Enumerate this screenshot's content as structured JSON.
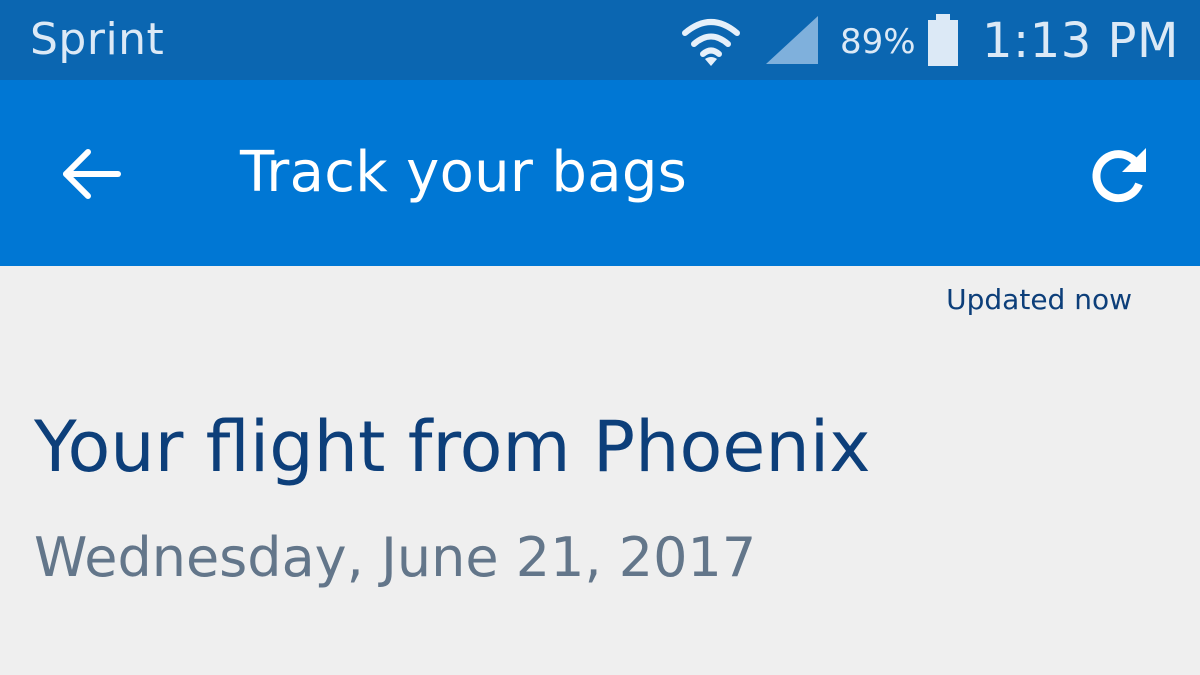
{
  "status_bar": {
    "carrier": "Sprint",
    "battery_percent": "89%",
    "time": "1:13 PM",
    "icons": {
      "wifi": "wifi-icon",
      "signal": "cellular-signal-icon",
      "battery": "battery-icon"
    }
  },
  "app_bar": {
    "title": "Track your bags",
    "back_icon": "arrow-left-icon",
    "refresh_icon": "refresh-icon"
  },
  "content": {
    "updated_label": "Updated now",
    "flight_title": "Your flight from Phoenix",
    "flight_date": "Wednesday, June 21, 2017"
  },
  "colors": {
    "status_bar_bg": "#0b66b1",
    "app_bar_bg": "#0077d4",
    "page_bg": "#efefef",
    "title_text": "#0d3f7a",
    "date_text": "#63768a"
  }
}
